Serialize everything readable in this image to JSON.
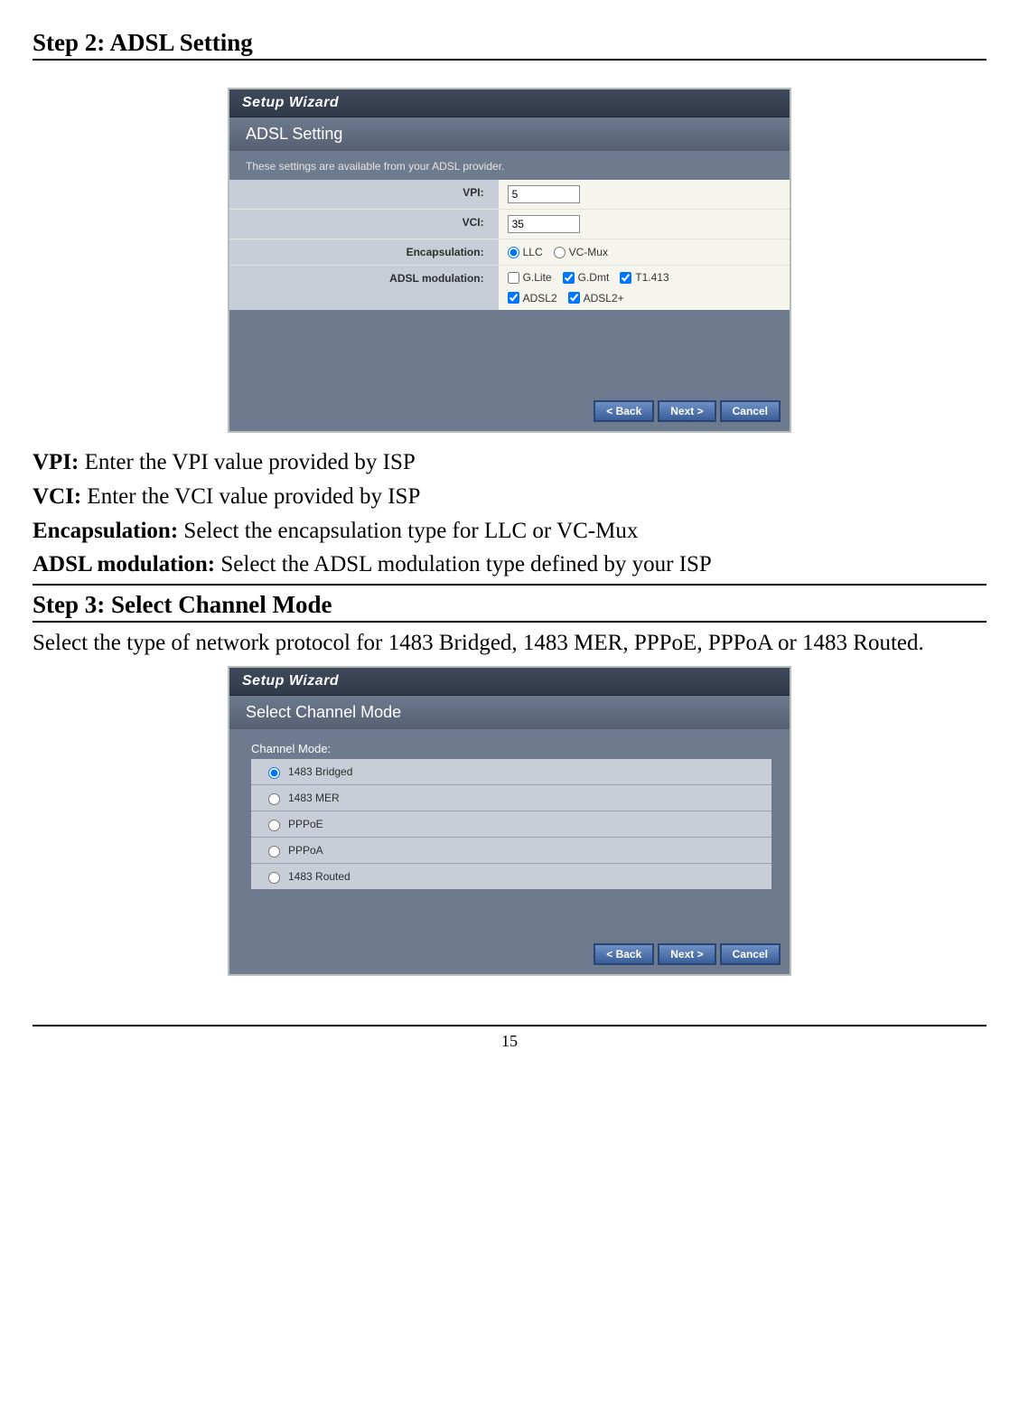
{
  "sections": {
    "step2": {
      "heading": "Step 2: ADSL Setting",
      "wizard_title": "Setup Wizard",
      "panel_title": "ADSL Setting",
      "note": "These settings are available from your ADSL provider.",
      "rows": {
        "vpi_label": "VPI:",
        "vpi_value": "5",
        "vci_label": "VCI:",
        "vci_value": "35",
        "encap_label": "Encapsulation:",
        "encap_options": {
          "llc": "LLC",
          "vcmux": "VC-Mux"
        },
        "mod_label": "ADSL modulation:",
        "mod_options": {
          "glite": "G.Lite",
          "gdmt": "G.Dmt",
          "t1413": "T1.413",
          "adsl2": "ADSL2",
          "adsl2p": "ADSL2+"
        }
      },
      "buttons": {
        "back": "< Back",
        "next": "Next >",
        "cancel": "Cancel"
      },
      "desc": {
        "vpi_b": "VPI:",
        "vpi_t": " Enter the VPI value provided by ISP",
        "vci_b": "VCI:",
        "vci_t": " Enter the VCI value provided by ISP",
        "enc_b": "Encapsulation:",
        "enc_t": " Select the encapsulation type for LLC or VC-Mux",
        "mod_b": "ADSL modulation:",
        "mod_t": " Select the ADSL modulation type defined by your ISP"
      }
    },
    "step3": {
      "heading": "Step 3: Select Channel Mode",
      "intro": "Select the type of network protocol for 1483 Bridged, 1483 MER, PPPoE, PPPoA or 1483 Routed.",
      "wizard_title": "Setup Wizard",
      "panel_title": "Select Channel Mode",
      "list_label": "Channel Mode:",
      "items": {
        "bridged": "1483 Bridged",
        "mer": "1483 MER",
        "pppoe": "PPPoE",
        "pppoa": "PPPoA",
        "routed": "1483 Routed"
      },
      "buttons": {
        "back": "< Back",
        "next": "Next >",
        "cancel": "Cancel"
      }
    }
  },
  "page_number": "15"
}
